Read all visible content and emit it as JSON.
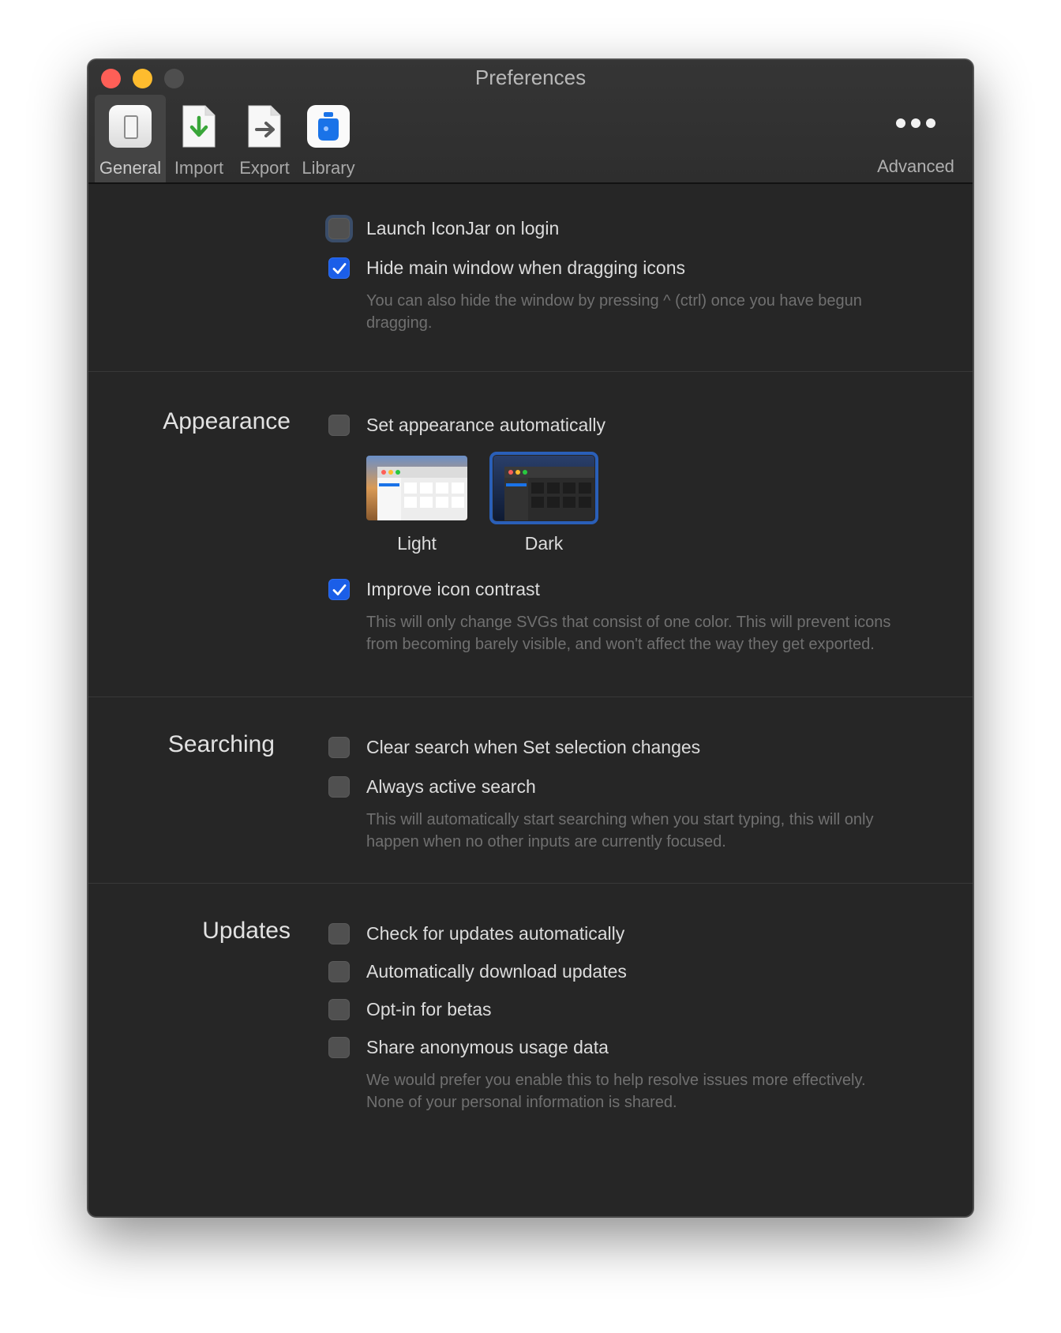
{
  "window": {
    "title": "Preferences"
  },
  "toolbar": {
    "tabs": [
      {
        "label": "General",
        "icon": "general-switch-icon",
        "selected": true
      },
      {
        "label": "Import",
        "icon": "import-document-icon"
      },
      {
        "label": "Export",
        "icon": "export-document-icon"
      },
      {
        "label": "Library",
        "icon": "library-jar-icon"
      }
    ],
    "advanced": {
      "label": "Advanced",
      "icon": "more-dots-icon"
    }
  },
  "general": {
    "launch_login": {
      "label": "Launch IconJar on login",
      "checked": false
    },
    "hide_window": {
      "label": "Hide main window when dragging icons",
      "checked": true
    },
    "hide_window_help": "You can also hide the window by pressing ^ (ctrl) once you have begun dragging."
  },
  "appearance": {
    "title": "Appearance",
    "auto": {
      "label": "Set appearance automatically",
      "checked": false
    },
    "themes": [
      {
        "label": "Light",
        "selected": false
      },
      {
        "label": "Dark",
        "selected": true
      }
    ],
    "contrast": {
      "label": "Improve icon contrast",
      "checked": true
    },
    "contrast_help": "This will only change SVGs that consist of one color. This will prevent icons from becoming barely visible, and won't affect the way they get exported."
  },
  "searching": {
    "title": "Searching",
    "clear_search": {
      "label": "Clear search when Set selection changes",
      "checked": false
    },
    "active_search": {
      "label": "Always active search",
      "checked": false
    },
    "active_search_help": "This will automatically start searching when you start typing, this will only happen when no other inputs are currently focused."
  },
  "updates": {
    "title": "Updates",
    "check_auto": {
      "label": "Check for updates automatically",
      "checked": false
    },
    "download_auto": {
      "label": "Automatically download updates",
      "checked": false
    },
    "betas": {
      "label": "Opt-in for betas",
      "checked": false
    },
    "usage_data": {
      "label": "Share anonymous usage data",
      "checked": false
    },
    "usage_help": "We would prefer you enable this to help resolve issues more effectively. None of your personal information is shared."
  },
  "colors": {
    "accent": "#1b5ee8",
    "window_bg": "#262626",
    "close": "#fe5f57",
    "minimize": "#febc2e"
  }
}
